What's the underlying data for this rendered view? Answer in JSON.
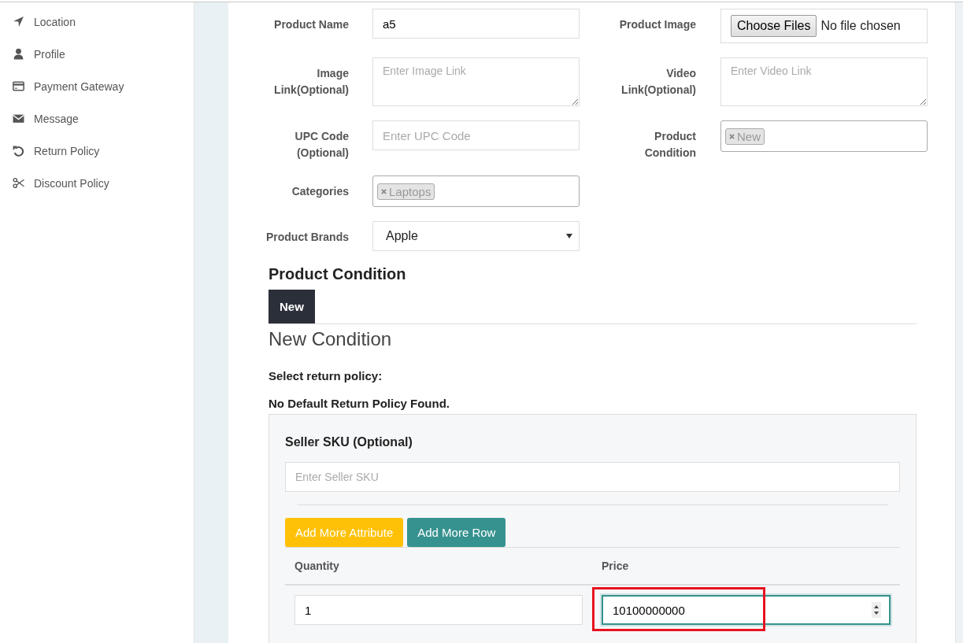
{
  "sidebar": {
    "items": [
      {
        "label": "Location"
      },
      {
        "label": "Profile"
      },
      {
        "label": "Payment Gateway"
      },
      {
        "label": "Message"
      },
      {
        "label": "Return Policy"
      },
      {
        "label": "Discount Policy"
      }
    ]
  },
  "form": {
    "rows": [
      [
        {
          "label": "Product Name",
          "kind": "text",
          "value": "a5"
        },
        {
          "label": "Product Image",
          "kind": "file",
          "button": "Choose Files",
          "status": "No file chosen"
        }
      ],
      [
        {
          "label": "Image Link(Optional)",
          "kind": "textarea",
          "placeholder": "Enter Image Link"
        },
        {
          "label": "Video Link(Optional)",
          "kind": "textarea",
          "placeholder": "Enter Video Link"
        }
      ],
      [
        {
          "label": "UPC Code (Optional)",
          "kind": "text",
          "placeholder": "Enter UPC Code"
        },
        {
          "label": "Product Condition",
          "kind": "tags",
          "tags": [
            "New"
          ]
        }
      ],
      [
        {
          "label": "Categories",
          "kind": "tags",
          "tags": [
            "Laptops"
          ]
        }
      ],
      [
        {
          "label": "Product Brands",
          "kind": "select",
          "value": "Apple"
        }
      ]
    ]
  },
  "condition": {
    "title": "Product Condition",
    "tabs": [
      {
        "label": "New",
        "selected": true
      }
    ],
    "subtitle": "New Condition",
    "return_label": "Select return policy:",
    "return_note": "No Default Return Policy Found.",
    "sku_label": "Seller SKU (Optional)",
    "sku_placeholder": "Enter Seller SKU",
    "buttons": [
      {
        "label": "Add More Attribute",
        "kind": "warning"
      },
      {
        "label": "Add More Row",
        "kind": "teal"
      }
    ],
    "columns": [
      "Quantity",
      "Price"
    ],
    "rows": [
      {
        "quantity": "1",
        "price": "10100000000",
        "price_focused": true,
        "price_highlighted": true
      }
    ]
  }
}
